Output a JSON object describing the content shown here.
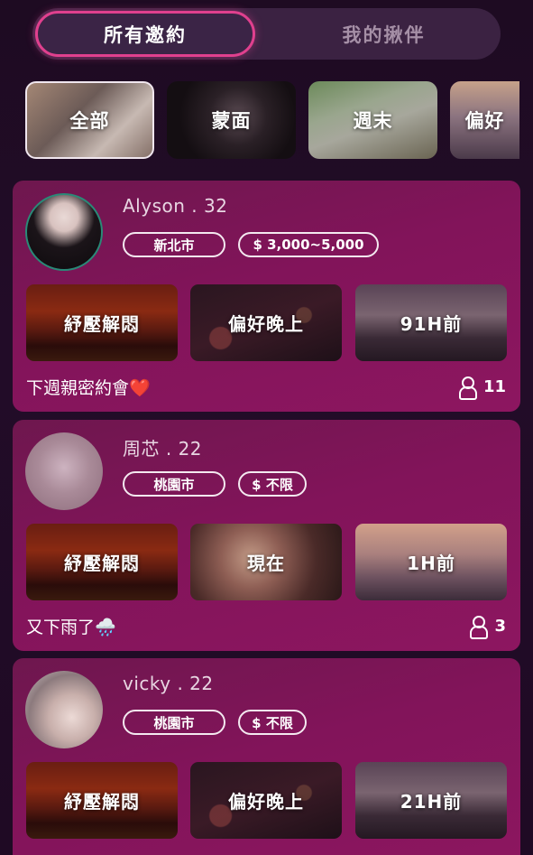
{
  "tabs": [
    {
      "label": "所有邀約",
      "active": true
    },
    {
      "label": "我的揪伴",
      "active": false
    }
  ],
  "categories": [
    {
      "label": "全部",
      "selected": true
    },
    {
      "label": "蒙面"
    },
    {
      "label": "週末"
    },
    {
      "label": "偏好"
    }
  ],
  "cards": [
    {
      "name": "Alyson . 32",
      "city": "新北市",
      "price": "$ 3,000~5,000",
      "tags": [
        "紓壓解悶",
        "偏好晚上",
        "91H前"
      ],
      "message": "下週親密約會❤️",
      "count": "11"
    },
    {
      "name": "周芯 . 22",
      "city": "桃園市",
      "price": "$ 不限",
      "tags": [
        "紓壓解悶",
        "現在",
        "1H前"
      ],
      "message": "又下雨了🌧️",
      "count": "3"
    },
    {
      "name": "vicky . 22",
      "city": "桃園市",
      "price": "$ 不限",
      "tags": [
        "紓壓解悶",
        "偏好晚上",
        "21H前"
      ]
    }
  ],
  "colors": {
    "accent": "#e0408e",
    "card": "#82145a"
  },
  "icons": {
    "count": "person-icon"
  }
}
